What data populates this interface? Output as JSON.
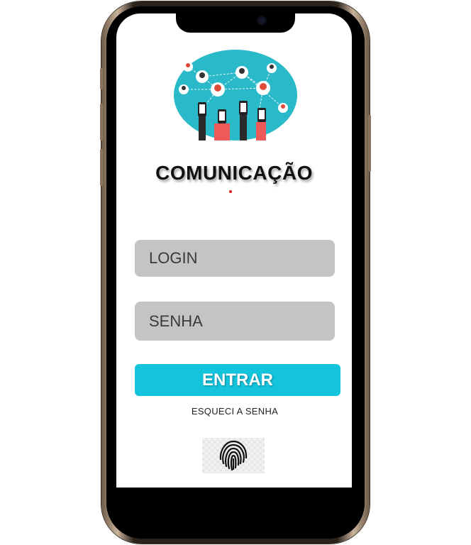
{
  "app": {
    "title": "COMUNICAÇÃO"
  },
  "login_form": {
    "login_placeholder": "LOGIN",
    "password_placeholder": "SENHA",
    "submit_label": "ENTRAR",
    "forgot_password_label": "ESQUECI A SENHA"
  },
  "icons": {
    "logo": "people-network-illustration",
    "biometric": "fingerprint-icon"
  },
  "colors": {
    "accent": "#13c4dc",
    "field_background": "#c4c4c4"
  }
}
